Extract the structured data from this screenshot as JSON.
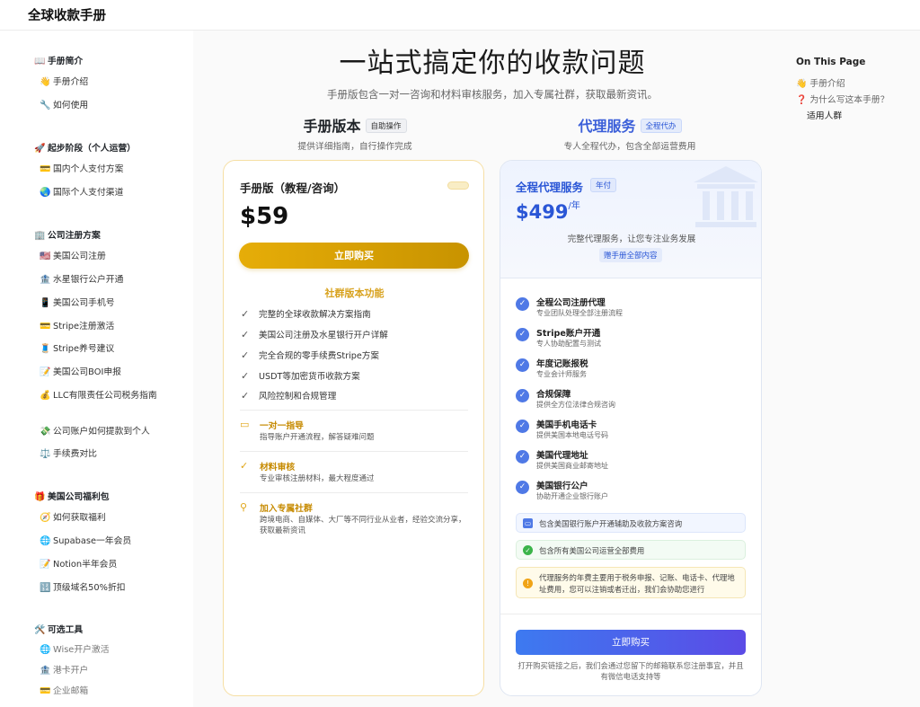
{
  "app": {
    "title": "全球收款手册"
  },
  "sidebar": {
    "sections": [
      {
        "emoji": "📖",
        "label": "手册简介",
        "items": [
          {
            "emoji": "👋",
            "label": "手册介绍"
          },
          {
            "emoji": "🔧",
            "label": "如何使用"
          }
        ]
      },
      {
        "emoji": "🚀",
        "label": "起步阶段（个人运营）",
        "items": [
          {
            "emoji": "💳",
            "label": "国内个人支付方案"
          },
          {
            "emoji": "🌏",
            "label": "国际个人支付渠道"
          }
        ]
      },
      {
        "emoji": "🏢",
        "label": "公司注册方案",
        "items": [
          {
            "emoji": "🇺🇸",
            "label": "美国公司注册"
          },
          {
            "emoji": "🏦",
            "label": "水星银行公户开通"
          },
          {
            "emoji": "📱",
            "label": "美国公司手机号"
          },
          {
            "emoji": "💳",
            "label": "Stripe注册激活"
          },
          {
            "emoji": "🧵",
            "label": "Stripe养号建议"
          },
          {
            "emoji": "📝",
            "label": "美国公司BOI申报"
          },
          {
            "emoji": "💰",
            "label": "LLC有限责任公司税务指南"
          },
          {
            "emoji": "💸",
            "label": "公司账户如何提款到个人"
          },
          {
            "emoji": "⚖️",
            "label": "手续费对比"
          }
        ]
      },
      {
        "emoji": "🎁",
        "label": "美国公司福利包",
        "items": [
          {
            "emoji": "🧭",
            "label": "如何获取福利"
          },
          {
            "emoji": "🌐",
            "label": "Supabase一年会员"
          },
          {
            "emoji": "📝",
            "label": "Notion半年会员"
          },
          {
            "emoji": "🔢",
            "label": "顶级域名50%折扣"
          }
        ]
      },
      {
        "emoji": "🛠️",
        "label": "可选工具",
        "items": [
          {
            "emoji": "🌐",
            "label": "Wise开户激活"
          },
          {
            "emoji": "🏦",
            "label": "港卡开户"
          },
          {
            "emoji": "💳",
            "label": "企业邮箱"
          }
        ]
      }
    ]
  },
  "main": {
    "title": "一站式搞定你的收款问题",
    "subtitle": "手册版包含一对一咨询和材料审核服务，加入专属社群，获取最新资讯。"
  },
  "plans": {
    "manual": {
      "name": "手册版本",
      "tag": "自助操作",
      "desc": "提供详细指南，自行操作完成",
      "card_title": "手册版（教程/咨询）",
      "price": "$59",
      "buy_label": "立即购买",
      "features_title": "社群版本功能",
      "features": [
        "完整的全球收款解决方案指南",
        "美国公司注册及水星银行开户详解",
        "完全合规的零手续费Stripe方案",
        "USDT等加密货币收款方案",
        "风险控制和合规管理"
      ],
      "extras": [
        {
          "icon": "card-icon",
          "title": "一对一指导",
          "desc": "指导账户开通流程，解答疑难问题"
        },
        {
          "icon": "check-icon",
          "title": "材料审核",
          "desc": "专业审核注册材料，最大程度通过"
        },
        {
          "icon": "user-icon",
          "title": "加入专属社群",
          "desc": "跨境电商、自媒体、大厂等不同行业从业者，经验交流分享，获取最新资讯"
        }
      ]
    },
    "agency": {
      "name": "代理服务",
      "tag": "全程代办",
      "desc": "专人全程代办，包含全部运营费用",
      "card_title": "全程代理服务",
      "card_tag": "年付",
      "price": "$499",
      "price_unit": "/年",
      "card_desc": "完整代理服务，让您专注业务发展",
      "gift": "赠手册全部内容",
      "items": [
        {
          "title": "全程公司注册代理",
          "desc": "专业团队处理全部注册流程"
        },
        {
          "title": "Stripe账户开通",
          "desc": "专人协助配置与测试"
        },
        {
          "title": "年度记账报税",
          "desc": "专业会计师服务"
        },
        {
          "title": "合规保障",
          "desc": "提供全方位法律合规咨询"
        },
        {
          "title": "美国手机电话卡",
          "desc": "提供美国本地电话号码"
        },
        {
          "title": "美国代理地址",
          "desc": "提供美国商业邮寄地址"
        },
        {
          "title": "美国银行公户",
          "desc": "协助开通企业银行账户"
        }
      ],
      "notes": {
        "blue": "包含美国银行账户开通辅助及收款方案咨询",
        "green": "包含所有美国公司运营全部费用",
        "yellow": "代理服务的年费主要用于税务申报、记账、电话卡、代理地址费用，您可以注销或者迁出，我们会协助您进行"
      },
      "buy_label": "立即购买",
      "footer_note": "打开购买链接之后，我们会通过您留下的邮箱联系您注册事宜，并且有微信电话支持等"
    }
  },
  "toc": {
    "title": "On This Page",
    "items": [
      {
        "emoji": "👋",
        "label": "手册介绍"
      },
      {
        "emoji": "❓",
        "label": "为什么写这本手册？"
      },
      {
        "emoji": "",
        "label": "适用人群"
      }
    ]
  },
  "colors": {
    "gold": "#e6ad08",
    "blue": "#2a56d6",
    "indigo": "#5b4be6"
  }
}
